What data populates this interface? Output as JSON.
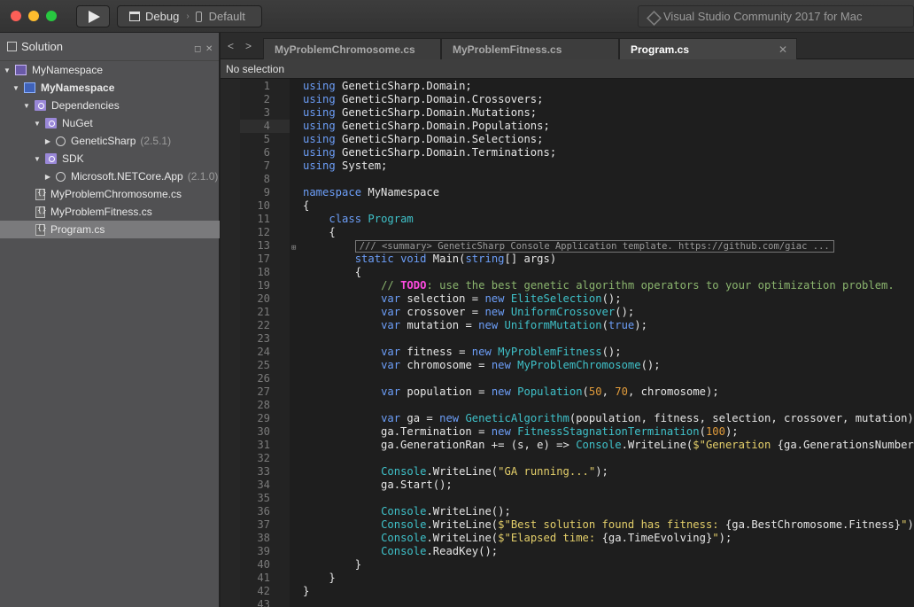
{
  "toolbar": {
    "config": "Debug",
    "separator": "›",
    "device": "Default",
    "app_title": "Visual Studio Community 2017 for Mac"
  },
  "solution_pane": {
    "title": "Solution",
    "items": [
      {
        "label": "MyNamespace",
        "version": ""
      },
      {
        "label": "MyNamespace",
        "version": ""
      },
      {
        "label": "Dependencies",
        "version": ""
      },
      {
        "label": "NuGet",
        "version": ""
      },
      {
        "label": "GeneticSharp",
        "version": "(2.5.1)"
      },
      {
        "label": "SDK",
        "version": ""
      },
      {
        "label": "Microsoft.NETCore.App",
        "version": "(2.1.0)"
      },
      {
        "label": "MyProblemChromosome.cs",
        "version": ""
      },
      {
        "label": "MyProblemFitness.cs",
        "version": ""
      },
      {
        "label": "Program.cs",
        "version": ""
      }
    ]
  },
  "tabs": [
    {
      "label": "MyProblemChromosome.cs"
    },
    {
      "label": "MyProblemFitness.cs"
    },
    {
      "label": "Program.cs"
    }
  ],
  "status": "No selection",
  "editor": {
    "collapsed_summary": "/// <summary> GeneticSharp Console Application template. https://github.com/giac ..."
  },
  "colors": {
    "keyword": "#6c9ef8",
    "type": "#3fc1c9",
    "string": "#e4cf6a",
    "number": "#e09b3b",
    "comment": "#8bb56e",
    "todo": "#ff4be1"
  }
}
